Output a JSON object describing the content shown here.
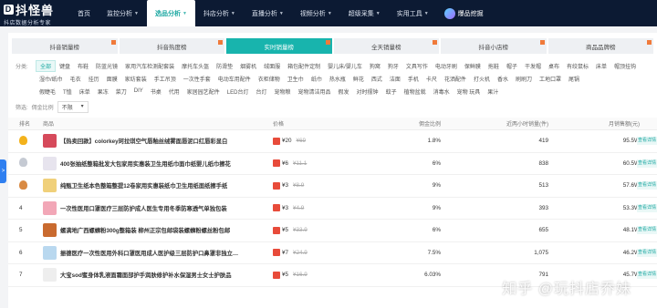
{
  "brand": {
    "name": "抖怪兽",
    "tagline": "抖店数据分析专家"
  },
  "nav": [
    {
      "label": "首页",
      "chevron": false
    },
    {
      "label": "监控分析",
      "chevron": true
    },
    {
      "label": "选品分析",
      "chevron": true,
      "active": true
    },
    {
      "label": "抖店分析",
      "chevron": true
    },
    {
      "label": "直播分析",
      "chevron": true
    },
    {
      "label": "视频分析",
      "chevron": true
    },
    {
      "label": "超级采集",
      "chevron": true
    },
    {
      "label": "实用工具",
      "chevron": true
    }
  ],
  "nav_special": "爆品挖掘",
  "side_handle": ">",
  "rank_tabs": [
    "抖音销量榜",
    "抖音热度榜",
    "实时销量榜",
    "全天销量榜",
    "抖音小店榜",
    "商品品牌榜"
  ],
  "active_rank_tab": 2,
  "category_label": "分类:",
  "categories_row1": [
    "全部",
    "键盘",
    "布鞋",
    "防蓝光镜",
    "家用汽车检测配套装",
    "摩托车头盔",
    "防滑垫",
    "烟雾机",
    "绒面服",
    "箱包配件定制",
    "婴儿床/婴儿车",
    "狗窝",
    "狗牙",
    "文具写作",
    "电动牙刷",
    "保鲜膜",
    "拖鞋",
    "帽子",
    "干发帽",
    "桌布",
    "有绞鼠标",
    "床单",
    "帽顶挂钩"
  ],
  "categories_row2": [
    "湿巾/纸巾",
    "毛衣",
    "挂历",
    "面膜",
    "家纺套装",
    "手工吊顶",
    "一次性手套",
    "电动车用配件",
    "衣柜储物",
    "卫生巾",
    "纸巾",
    "热水瓶",
    "鲜花",
    "西式",
    "洁面",
    "手机",
    "卡尺",
    "花洒配件",
    "打火机",
    "香水",
    "刷刷刀",
    "工地口罩",
    "尾锅"
  ],
  "categories_row3": [
    "假睫毛",
    "T恤",
    "床单",
    "果冻",
    "菜刀",
    "DIY",
    "书桌",
    "代用",
    "家居园艺配件",
    "LED台灯",
    "台灯",
    "宠物粮",
    "宠物清洁用品",
    "假发",
    "对时摆钟",
    "蚊子",
    "植物盆栽",
    "消毒水",
    "宠物 玩具",
    "果汁"
  ],
  "filter_label": "筛选:",
  "filter_select_label": "佣金比例",
  "filter_select_value": "不限",
  "table_headers": {
    "rank": "排名",
    "product": "商品",
    "price": "价格",
    "commission": "佣金比例",
    "sales": "近两小时销量(件)",
    "monthly": "月销售额(元)"
  },
  "rows": [
    {
      "rank": "1",
      "medal": "gold",
      "name": "【热卖回款】colorkey珂拉琪空气唇釉丝绒雾面唇泥口红唇彩显白",
      "price": "¥20",
      "old": "¥69",
      "commission": "1.8%",
      "sales": "419",
      "monthly": "95.5W",
      "action": "查看详情",
      "thumb": "#d64a5b"
    },
    {
      "rank": "2",
      "medal": "silver",
      "name": "400张抽纸整箱批发大包家用实惠装卫生用纸巾面巾纸婴儿纸巾擦花",
      "price": "¥6",
      "old": "¥11.1",
      "commission": "6%",
      "sales": "838",
      "monthly": "60.5W",
      "action": "查看详情",
      "thumb": "#e7e4ee"
    },
    {
      "rank": "3",
      "medal": "bronze",
      "name": "纯甄卫生纸本色整箱整提12卷家用实惠装纸巾卫生用纸面纸擦手纸",
      "price": "¥3",
      "old": "¥8.9",
      "commission": "9%",
      "sales": "513",
      "monthly": "57.6W",
      "action": "查看详情",
      "thumb": "#f0d07a"
    },
    {
      "rank": "4",
      "medal": "",
      "name": "一次性医用口罩医疗三层防护成人医生专用冬季防寒透气单独包装",
      "price": "¥3",
      "old": "¥4.9",
      "commission": "9%",
      "sales": "393",
      "monthly": "53.3W",
      "action": "查看详情",
      "thumb": "#f2a7b7"
    },
    {
      "rank": "5",
      "medal": "",
      "name": "螺满地广西螺蛳粉300g整箱装 柳州正宗包邮袋装螺蛳粉螺丝粉包邮",
      "price": "¥5",
      "old": "¥33.9",
      "commission": "6%",
      "sales": "655",
      "monthly": "48.1W",
      "action": "查看详情",
      "thumb": "#c96a2f"
    },
    {
      "rank": "6",
      "medal": "",
      "name": "振德医疗一次性医用外科口罩医用成人医护级三层防护口鼻罩非独立包装",
      "price": "¥7",
      "old": "¥24.9",
      "commission": "7.5%",
      "sales": "1,075",
      "monthly": "46.2W",
      "action": "查看详情",
      "thumb": "#b9d8ef"
    },
    {
      "rank": "7",
      "medal": "",
      "name": "大宝sod蜜身体乳液面霜面部护手润肤修护补水保湿男士女士护肤品",
      "price": "¥5",
      "old": "¥16.9",
      "commission": "6.03%",
      "sales": "791",
      "monthly": "45.7W",
      "action": "查看详情",
      "thumb": "#eeeeee"
    }
  ],
  "watermark": "知乎 @玩抖店乔妹"
}
